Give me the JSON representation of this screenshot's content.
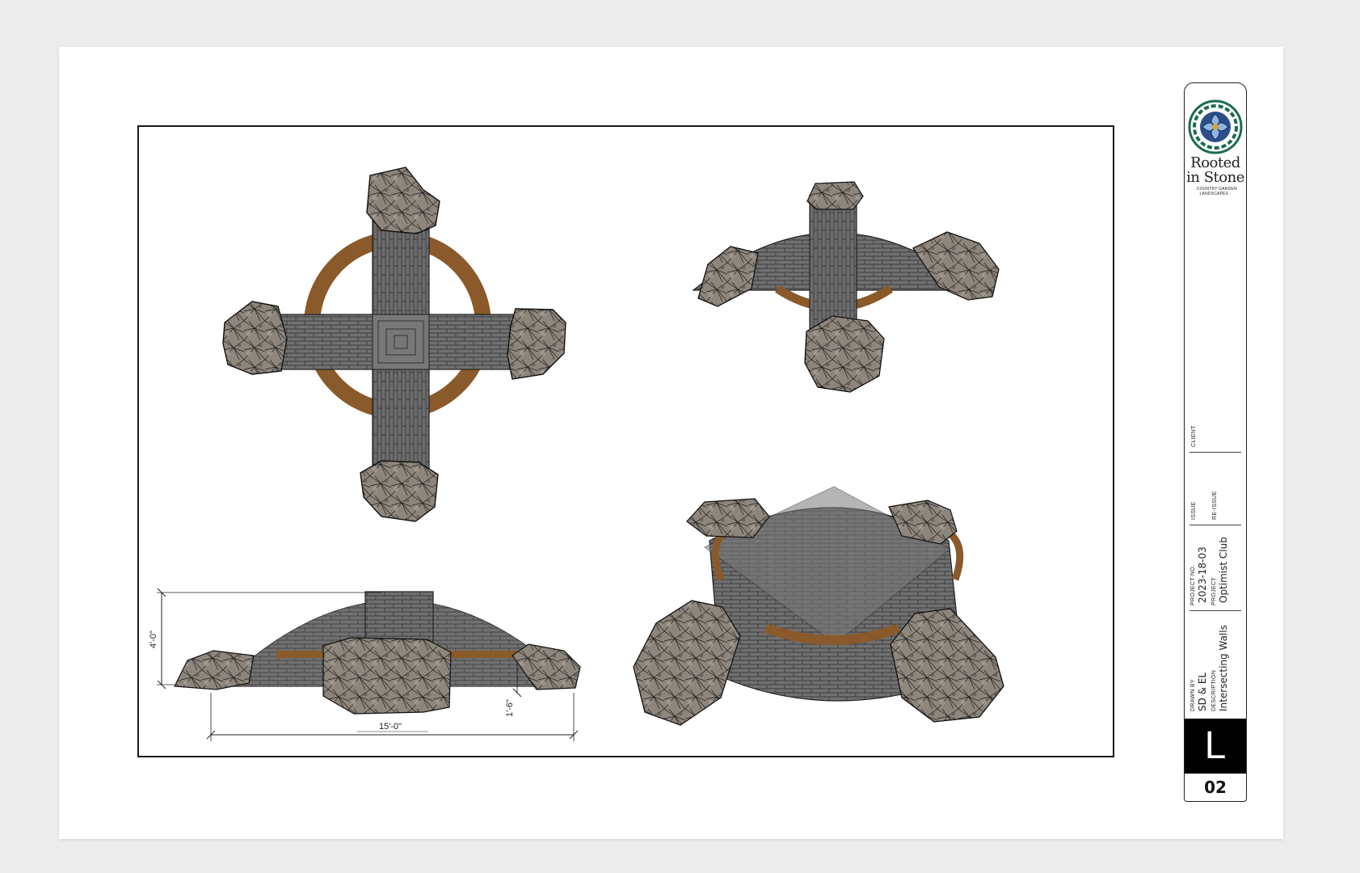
{
  "sheet": {
    "company": {
      "name_line1": "Rooted",
      "name_line2": "in Stone",
      "tagline": "· COUNTRY GARDEN LANDSCAPES ·",
      "logo": "celtic-knot-emblem"
    },
    "fields": {
      "client_label": "CLIENT",
      "client_value": "",
      "issue_label": "ISSUE",
      "reissue_label": "RE-ISSUE",
      "project_no_label": "PROJECT NO.",
      "project_no_value": "2023-18-03",
      "project_label": "PROJECT",
      "project_value": "Optimist Club",
      "drawn_by_label": "DRAWN BY",
      "drawn_by_value": "SD & EL",
      "description_label": "DESCRIPTION",
      "description_value": "Intersecting Walls"
    },
    "sheet_letter": "L",
    "sheet_number": "02"
  },
  "drawing": {
    "dimensions": {
      "height": "4'-0\"",
      "width": "15'-0\"",
      "step": "1'-6\""
    },
    "colors": {
      "stone": "#6b6b6b",
      "boulder": "#8d8478",
      "cap_ring": "#8a5a2b",
      "frame": "#1a1a1a"
    }
  }
}
